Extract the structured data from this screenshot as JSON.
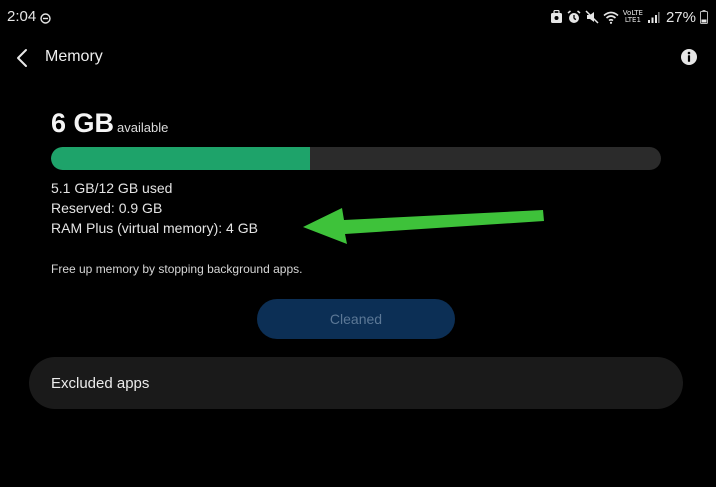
{
  "status_bar": {
    "time": "2:04",
    "battery_text": "27%",
    "network_label_top": "VoLTE",
    "network_label_bottom": "LTE1",
    "icons": [
      "do-not-disturb-icon",
      "data-saver-icon",
      "alarm-icon",
      "mute-icon",
      "wifi-icon",
      "signal-icon",
      "battery-icon"
    ]
  },
  "header": {
    "title": "Memory",
    "back_icon": "chevron-left-icon",
    "info_icon": "info-icon"
  },
  "memory": {
    "available_value": "6 GB",
    "available_label": "available",
    "used_fraction": 0.425,
    "used_text": "5.1 GB/12 GB used",
    "reserved_text": "Reserved: 0.9 GB",
    "ram_plus_text": "RAM Plus (virtual memory): 4 GB",
    "hint": "Free up memory by stopping background apps."
  },
  "clean_button": {
    "label": "Cleaned",
    "state": "disabled"
  },
  "excluded_apps": {
    "label": "Excluded apps"
  },
  "colors": {
    "background": "#000000",
    "bar_fill": "#1ea36a",
    "bar_track": "#2b2b2b",
    "button_bg": "#0c2f55",
    "card_bg": "#1a1a1a",
    "annotation_arrow": "#3ec23a"
  }
}
